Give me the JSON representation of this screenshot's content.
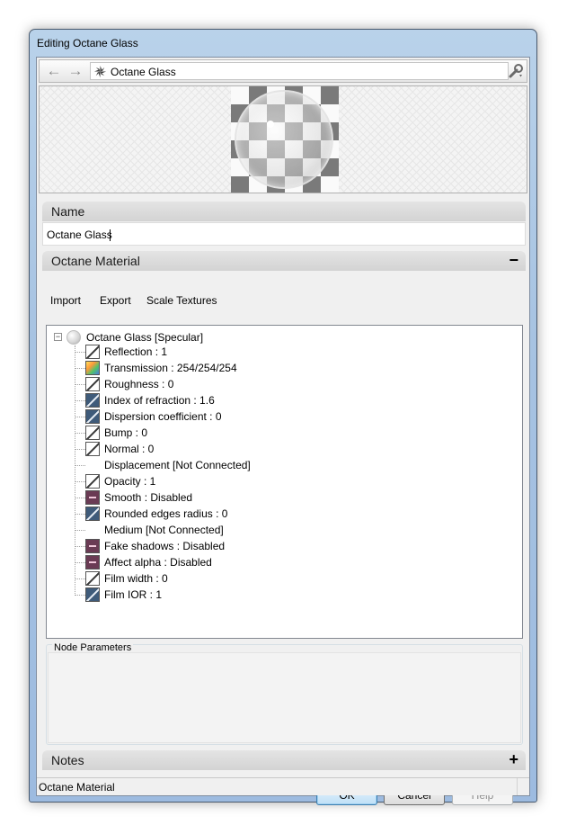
{
  "window": {
    "title": "Editing Octane Glass"
  },
  "nav": {
    "path_label": "Octane Glass"
  },
  "name_section": {
    "title": "Name",
    "value": "Octane Glass"
  },
  "material_section": {
    "title": "Octane Material",
    "toggle": "−"
  },
  "toolbar": {
    "import_label": "Import",
    "export_label": "Export",
    "scale_textures_label": "Scale Textures"
  },
  "tree": {
    "root": {
      "expander": "−",
      "label": "Octane Glass  [Specular]"
    },
    "items": [
      {
        "label": "Reflection : 1",
        "icon": "float-pin-icon"
      },
      {
        "label": "Transmission : 254/254/254",
        "icon": "rgb-pin-icon"
      },
      {
        "label": "Roughness : 0",
        "icon": "float-pin-icon"
      },
      {
        "label": "Index of refraction : 1.6",
        "icon": "float-dark-pin-icon"
      },
      {
        "label": "Dispersion coefficient : 0",
        "icon": "float-dark-pin-icon"
      },
      {
        "label": "Bump : 0",
        "icon": "float-pin-icon"
      },
      {
        "label": "Normal : 0",
        "icon": "float-pin-icon"
      },
      {
        "label": "Displacement  [Not Connected]",
        "icon": "none"
      },
      {
        "label": "Opacity : 1",
        "icon": "float-pin-icon"
      },
      {
        "label": "Smooth : Disabled",
        "icon": "bool-pin-icon"
      },
      {
        "label": "Rounded edges radius : 0",
        "icon": "float-dark-pin-icon"
      },
      {
        "label": "Medium  [Not Connected]",
        "icon": "none"
      },
      {
        "label": "Fake shadows : Disabled",
        "icon": "bool-pin-icon"
      },
      {
        "label": "Affect alpha : Disabled",
        "icon": "bool-pin-icon"
      },
      {
        "label": "Film width : 0",
        "icon": "float-pin-icon"
      },
      {
        "label": "Film IOR : 1",
        "icon": "float-dark-pin-icon"
      }
    ]
  },
  "node_parameters": {
    "title": "Node Parameters"
  },
  "notes_section": {
    "title": "Notes",
    "toggle": "+"
  },
  "buttons": {
    "ok": "OK",
    "cancel": "Cancel",
    "help": "Help"
  },
  "status": {
    "text": "Octane Material"
  }
}
